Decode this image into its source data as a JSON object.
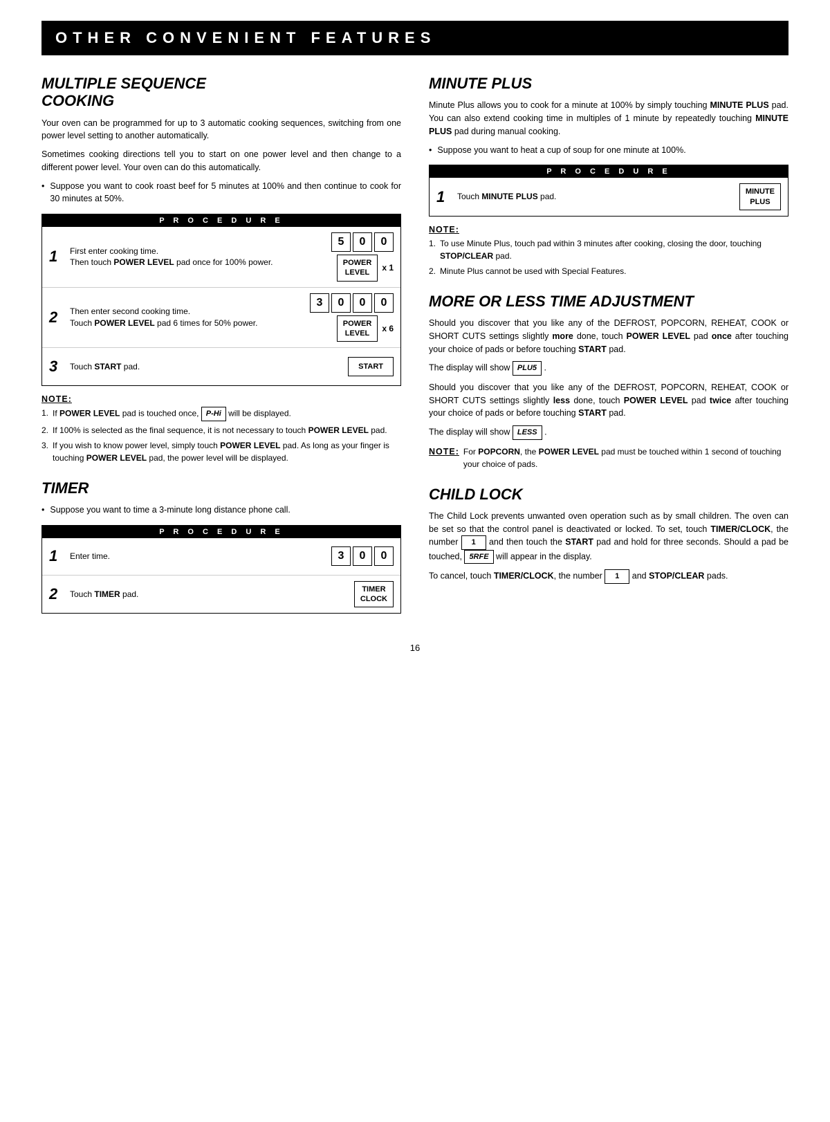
{
  "header": {
    "title": "OTHER CONVENIENT FEATURES"
  },
  "left_col": {
    "multiple_sequence": {
      "title": "MULTIPLE SEQUENCE COOKING",
      "para1": "Your oven can be programmed for up to 3 automatic cooking sequences, switching from one power level setting to another automatically.",
      "para2": "Sometimes cooking directions tell you to start on one power level and then change to a different power level. Your oven can do this automatically.",
      "bullet1": "Suppose you want to cook roast beef for 5 minutes at 100% and then continue to cook for 30 minutes at 50%.",
      "procedure_label": "PROCEDURE",
      "steps": [
        {
          "num": "1",
          "text": "First enter cooking time. Then touch POWER LEVEL pad once for 100% power.",
          "keys": [
            "5",
            "0",
            "0"
          ],
          "extra_label": "POWER\nLEVEL",
          "multiplier": "x 1"
        },
        {
          "num": "2",
          "text": "Then enter second cooking time. Touch POWER LEVEL pad 6 times for 50% power.",
          "keys": [
            "3",
            "0",
            "0",
            "0"
          ],
          "extra_label": "POWER\nLEVEL",
          "multiplier": "x 6"
        },
        {
          "num": "3",
          "text": "Touch START pad.",
          "start_label": "START"
        }
      ],
      "note_title": "NOTE:",
      "notes": [
        "If POWER LEVEL pad is touched once, P-HI will be displayed.",
        "If 100% is selected as the final sequence, it is not necessary to touch POWER LEVEL pad.",
        "If you wish to know power level, simply touch POWER LEVEL pad. As long as your finger is touching POWER LEVEL pad, the power level will be displayed."
      ]
    },
    "timer": {
      "title": "TIMER",
      "bullet1": "Suppose you want to time a 3-minute long distance phone call.",
      "procedure_label": "PROCEDURE",
      "steps": [
        {
          "num": "1",
          "text": "Enter time.",
          "keys": [
            "3",
            "0",
            "0"
          ]
        },
        {
          "num": "2",
          "text": "Touch TIMER pad.",
          "label": "TIMER\nCLOCK"
        }
      ]
    }
  },
  "right_col": {
    "minute_plus": {
      "title": "MINUTE PLUS",
      "para1": "Minute Plus allows you to cook for a minute at 100% by simply touching MINUTE PLUS pad. You can also extend cooking time in multiples of 1 minute by repeatedly touching MINUTE PLUS pad during manual cooking.",
      "bullet1": "Suppose you want to heat a cup of soup for one minute at 100%.",
      "procedure_label": "PROCEDURE",
      "step1_num": "1",
      "step1_text": "Touch MINUTE PLUS pad.",
      "step1_label": "MINUTE\nPLUS",
      "note_title": "NOTE:",
      "notes": [
        "To use Minute Plus, touch pad within 3 minutes after cooking, closing the door, touching STOP/CLEAR pad.",
        "Minute Plus cannot be used with Special Features."
      ]
    },
    "more_or_less": {
      "title": "MORE OR LESS TIME ADJUSTMENT",
      "para1": "Should you discover that you like any of the DEFROST, POPCORN, REHEAT, COOK or SHORT CUTS settings slightly more done, touch POWER LEVEL pad once after touching your choice of pads or before touching START pad.",
      "display1": "PLU5",
      "para2": "Should you discover that you like any of the DEFROST, POPCORN, REHEAT, COOK or SHORT CUTS settings slightly less done, touch POWER LEVEL pad twice after touching your choice of pads or before touching START pad.",
      "display2": "LESS",
      "note_bold": "NOTE:",
      "note_text": "For POPCORN, the POWER LEVEL pad must be touched within 1 second of touching your choice of pads."
    },
    "child_lock": {
      "title": "CHILD LOCK",
      "para1": "The Child Lock prevents unwanted oven operation such as by small children. The oven can be set so that the control panel is deactivated or locked. To set, touch TIMER/CLOCK, the number 1 and then touch the START pad and hold for three seconds. Should a pad be touched, 5RFE will appear in the display.",
      "para2": "To cancel, touch TIMER/CLOCK, the number 1 and STOP/CLEAR pads."
    }
  },
  "page_number": "16",
  "display_phi": "P-Hi",
  "display_plus": "PLU5",
  "display_less": "LESS",
  "display_safe": "5RFE"
}
